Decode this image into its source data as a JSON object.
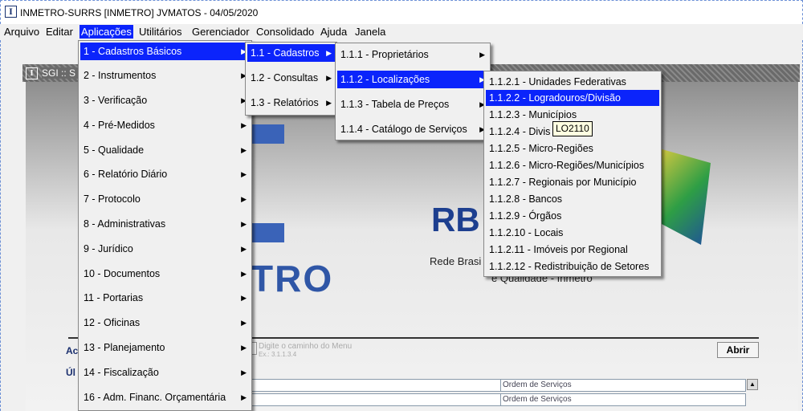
{
  "window": {
    "title": "INMETRO-SURRS  [INMETRO]   JVMATOS - 04/05/2020"
  },
  "menubar": {
    "items": [
      "Arquivo",
      "Editar",
      "Aplicações",
      "Utilitários",
      "Gerenciador",
      "Consolidado",
      "Ajuda",
      "Janela"
    ],
    "selected": "Aplicações"
  },
  "inner_window": {
    "title": "SGI :: S"
  },
  "background": {
    "tro": "TRO",
    "rb": "RB",
    "rede": "Rede Brasi",
    "quali": "e Qualidade - Inmetro",
    "acao_label": "Ac",
    "ultimos_label": "Úl",
    "path_hint": "Digite o caminho do Menu",
    "path_example": "Ex.: 3.1.1.3.4",
    "abrir_button": "Abrir",
    "grid_rows": [
      "Ordem de Serviços",
      "Ordem de Serviços"
    ]
  },
  "menu_level1": {
    "items": [
      "1 - Cadastros Básicos",
      "2 - Instrumentos",
      "3 - Verificação",
      "4 - Pré-Medidos",
      "5 - Qualidade",
      "6 - Relatório Diário",
      "7 - Protocolo",
      "8 - Administrativas",
      "9 - Jurídico",
      "10 - Documentos",
      "11 - Portarias",
      "12 - Oficinas",
      "13 - Planejamento",
      "14 - Fiscalização",
      "16 - Adm. Financ. Orçamentária"
    ],
    "selected_index": 0
  },
  "menu_level2": {
    "items": [
      "1.1 - Cadastros",
      "1.2 - Consultas",
      "1.3 - Relatórios"
    ],
    "selected_index": 0
  },
  "menu_level3": {
    "items": [
      "1.1.1 - Proprietários",
      "1.1.2 - Localizações",
      "1.1.3 - Tabela de Preços",
      "1.1.4 - Catálogo de Serviços"
    ],
    "selected_index": 1
  },
  "menu_level4": {
    "items": [
      "1.1.2.1 - Unidades Federativas",
      "1.1.2.2 - Logradouros/Divisão",
      "1.1.2.3 - Municípios",
      "1.1.2.4 - Divis",
      "1.1.2.5 - Micro-Regiões",
      "1.1.2.6 - Micro-Regiões/Municípios",
      "1.1.2.7 - Regionais por Município",
      "1.1.2.8 - Bancos",
      "1.1.2.9 - Órgãos",
      "1.1.2.10 - Locais",
      "1.1.2.11 - Imóveis por Regional",
      "1.1.2.12 - Redistribuição de Setores"
    ],
    "selected_index": 1
  },
  "tooltip": {
    "text": "LO2110"
  },
  "icons": {
    "app": "inmetro-app-icon",
    "submenu": "submenu-arrow-icon"
  },
  "colors": {
    "selection": "#0b24fb",
    "tooltip_bg": "#ffffe1"
  }
}
